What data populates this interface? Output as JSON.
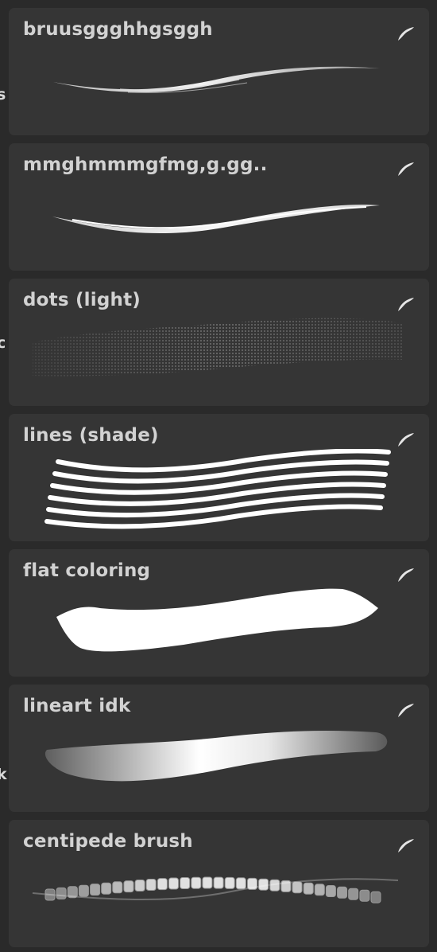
{
  "left_edge_fragments": [
    "s",
    "c",
    "k"
  ],
  "brushes": [
    {
      "name": "bruusggghhgsggh",
      "stroke": "bristle"
    },
    {
      "name": "mmghmmmgfmg,g.gg..",
      "stroke": "smooth-tapered"
    },
    {
      "name": "dots (light)",
      "stroke": "dots"
    },
    {
      "name": "lines (shade)",
      "stroke": "parallel-lines"
    },
    {
      "name": "flat coloring",
      "stroke": "flat"
    },
    {
      "name": "lineart idk",
      "stroke": "soft-lineart"
    },
    {
      "name": "centipede brush",
      "stroke": "segmented"
    }
  ],
  "source_icon": "procreate-brush-icon",
  "colors": {
    "background": "#2a2a2a",
    "card": "#353535",
    "text": "#d2d2d2",
    "stroke": "#ffffff"
  }
}
